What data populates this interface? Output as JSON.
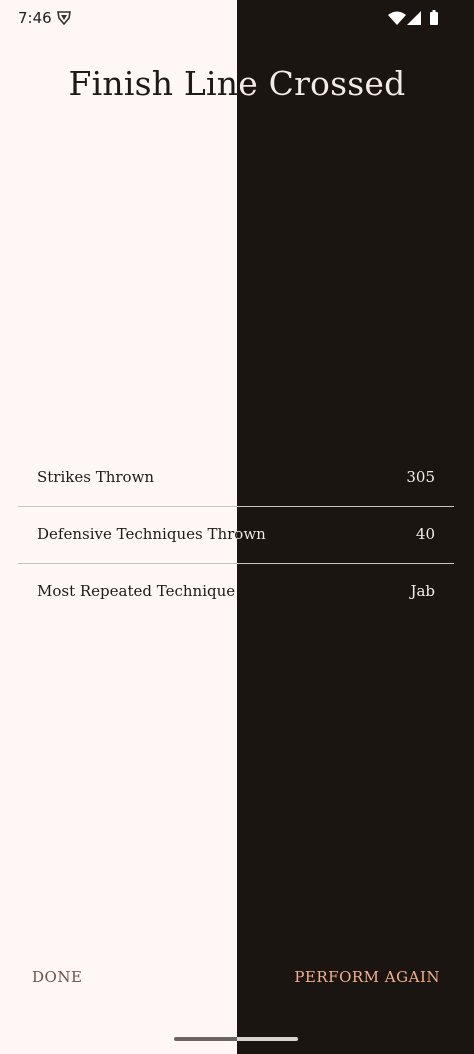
{
  "status_bar": {
    "time": "7:46",
    "icons": [
      "shield-icon",
      "wifi-icon",
      "signal-icon",
      "battery-icon"
    ]
  },
  "title": "Finish Line Crossed",
  "stats": [
    {
      "label": "Strikes Thrown",
      "value": "305"
    },
    {
      "label": "Defensive Techniques Thrown",
      "value": "40"
    },
    {
      "label": "Most Repeated Technique",
      "value": "Jab"
    }
  ],
  "actions": {
    "done_label": "DONE",
    "perform_again_label": "PERFORM AGAIN"
  },
  "colors": {
    "light_background": "#fff7f5",
    "dark_background": "#1b1512",
    "done_text": "#6d5245",
    "perform_again_text": "#f2b08d"
  }
}
